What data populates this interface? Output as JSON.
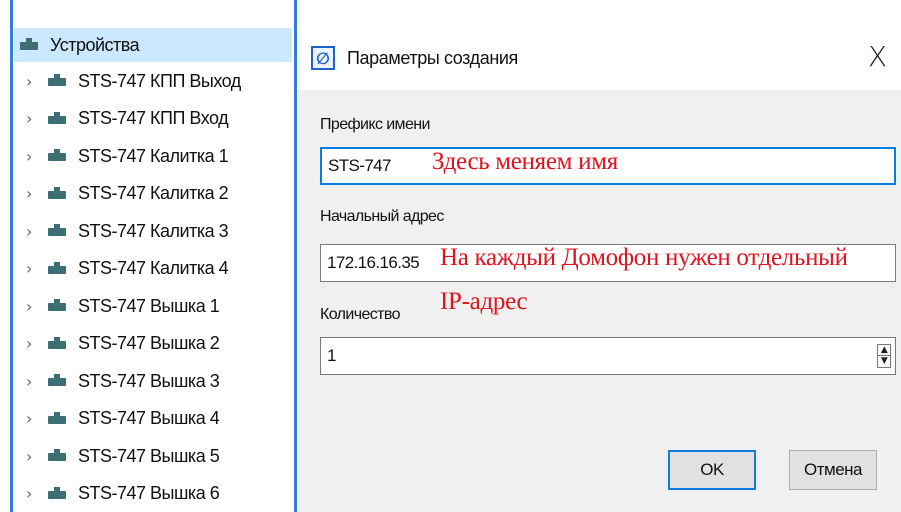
{
  "tree": {
    "root_label": "Устройства",
    "items": [
      {
        "label": "STS-747 КПП Выход"
      },
      {
        "label": "STS-747 КПП Вход"
      },
      {
        "label": "STS-747 Калитка 1"
      },
      {
        "label": "STS-747 Калитка 2"
      },
      {
        "label": "STS-747 Калитка 3"
      },
      {
        "label": "STS-747 Калитка 4"
      },
      {
        "label": "STS-747 Вышка 1"
      },
      {
        "label": "STS-747 Вышка 2"
      },
      {
        "label": "STS-747 Вышка 3"
      },
      {
        "label": "STS-747 Вышка 4"
      },
      {
        "label": "STS-747 Вышка 5"
      },
      {
        "label": "STS-747 Вышка 6"
      }
    ],
    "expand_glyph": "›",
    "device_icon": "device-icon"
  },
  "dialog": {
    "title": "Параметры создания",
    "title_icon": "create-params-icon",
    "close_glyph": "X",
    "prefix_label": "Префикс имени",
    "prefix_value": "STS-747",
    "start_address_label": "Начальный адрес",
    "start_address_value": "172.16.16.35",
    "count_label": "Количество",
    "count_value": "1",
    "ok_label": "OK",
    "cancel_label": "Отмена"
  },
  "annotations": {
    "name_note": "Здесь меняем имя",
    "address_note_line1": "На каждый Домофон нужен отдельный",
    "address_note_line2": "IP-адрес"
  },
  "colors": {
    "accent": "#0a7ee0",
    "annotation": "#e0141e",
    "selection": "#cce8ff"
  }
}
